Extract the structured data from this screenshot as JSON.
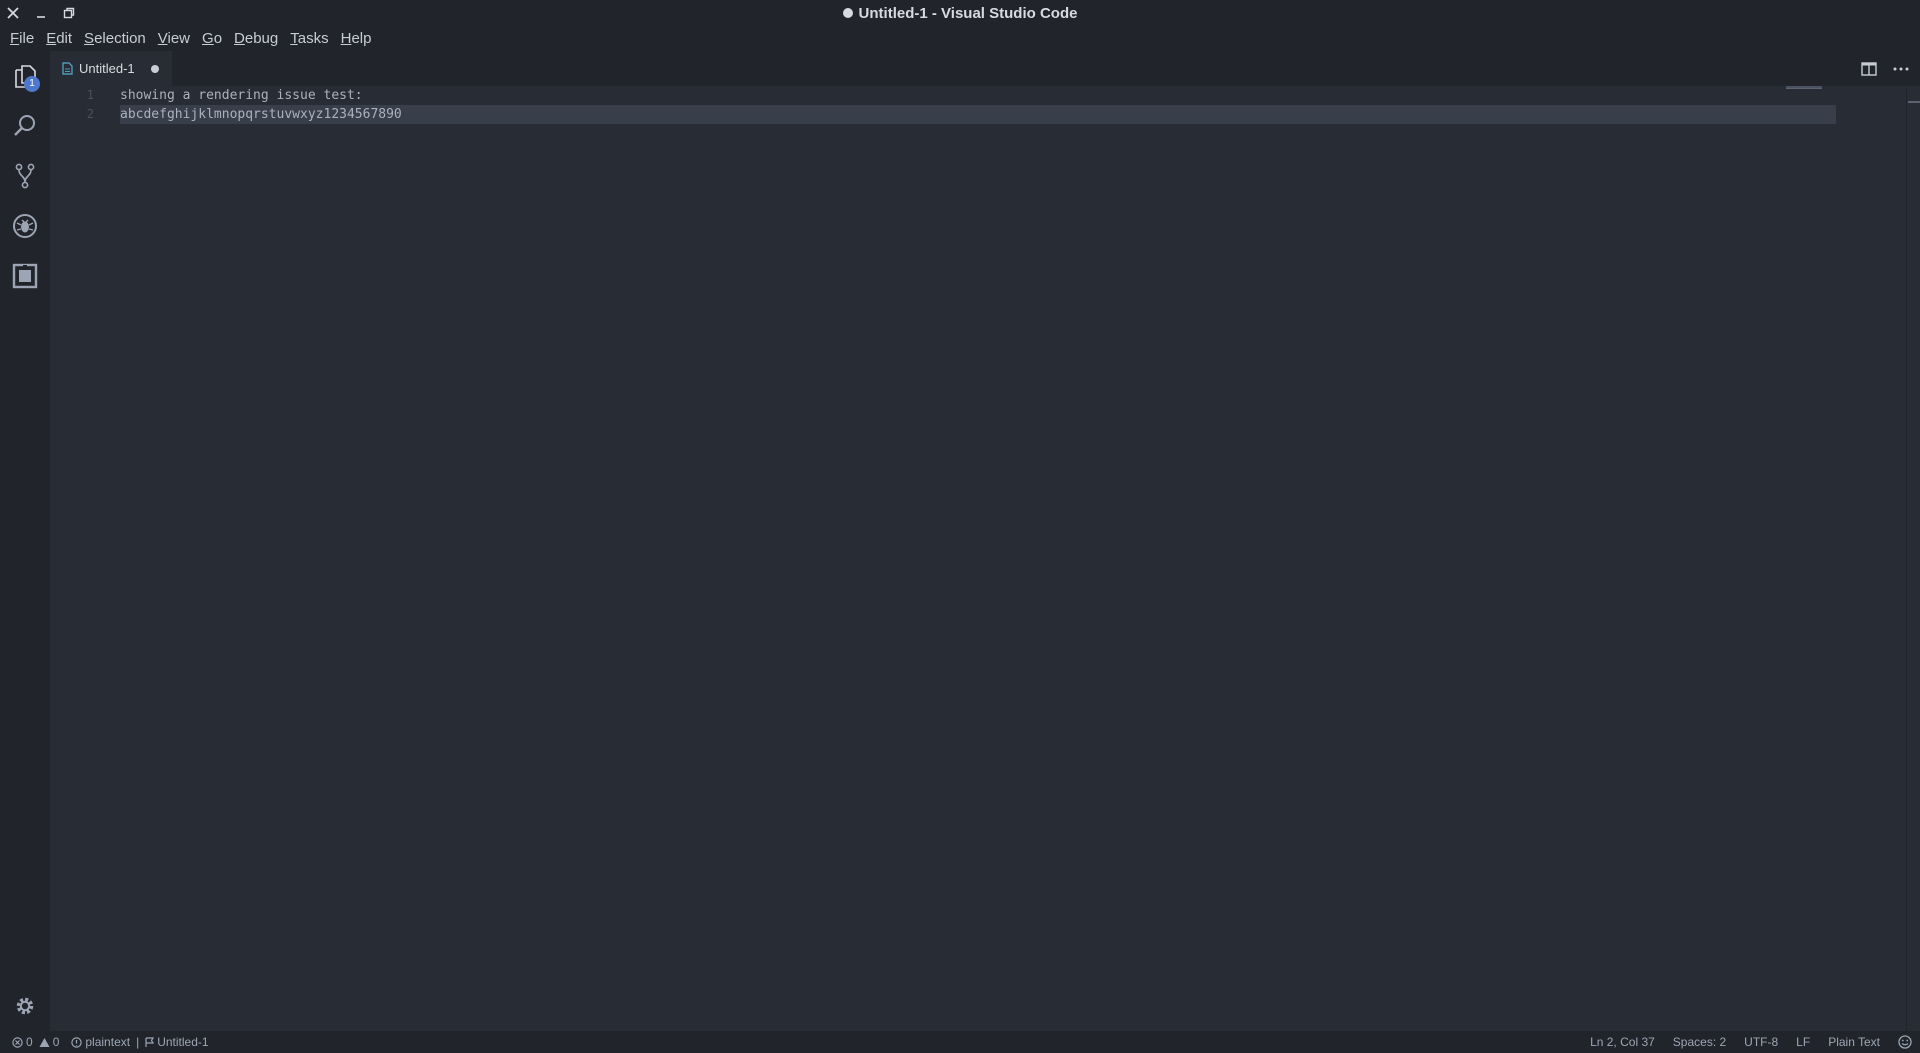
{
  "window": {
    "title": "Untitled-1 - Visual Studio Code"
  },
  "menu": {
    "items": [
      {
        "mnemonic": "F",
        "rest": "ile"
      },
      {
        "mnemonic": "E",
        "rest": "dit"
      },
      {
        "mnemonic": "S",
        "rest": "election"
      },
      {
        "mnemonic": "V",
        "rest": "iew"
      },
      {
        "mnemonic": "G",
        "rest": "o"
      },
      {
        "mnemonic": "D",
        "rest": "ebug"
      },
      {
        "mnemonic": "T",
        "rest": "asks"
      },
      {
        "mnemonic": "H",
        "rest": "elp"
      }
    ]
  },
  "activity": {
    "explorer_badge": "1",
    "icons": [
      "files-icon",
      "search-icon",
      "source-control-icon",
      "debug-icon",
      "extensions-icon",
      "gear-icon"
    ]
  },
  "tab": {
    "label": "Untitled-1"
  },
  "editor": {
    "lines": [
      {
        "number": "1",
        "text": "showing a rendering issue test:"
      },
      {
        "number": "2",
        "text": "abcdefghijklmnopqrstuvwxyz1234567890"
      }
    ]
  },
  "status": {
    "errors": "0",
    "warnings": "0",
    "language_id": "plaintext",
    "file": "Untitled-1",
    "position": "Ln 2, Col 37",
    "indent": "Spaces: 2",
    "encoding": "UTF-8",
    "eol": "LF",
    "language": "Plain Text"
  },
  "colors": {
    "background": "#282c34",
    "chrome": "#21252b",
    "badge": "#4d78cc",
    "tab_icon": "#519aba"
  }
}
